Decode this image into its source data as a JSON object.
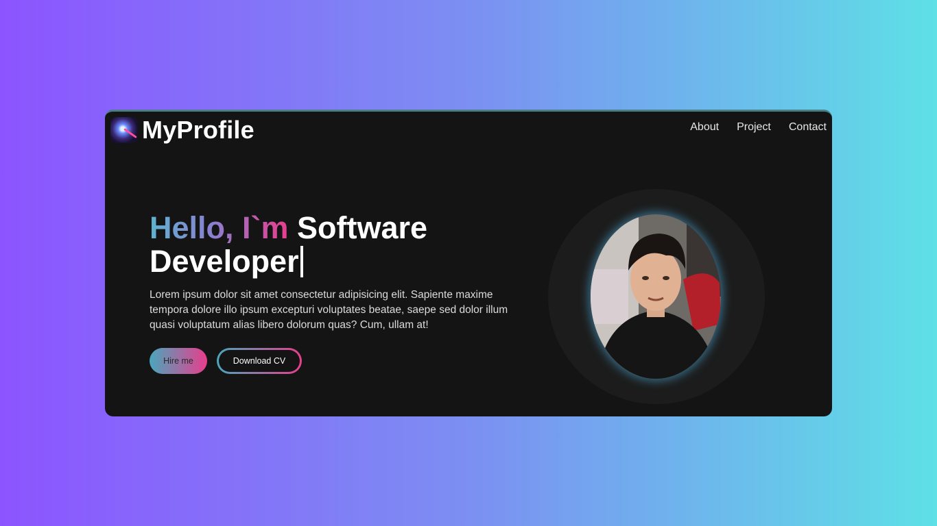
{
  "brand": {
    "name": "MyProfile",
    "logo_icon": "galaxy-logo-icon"
  },
  "nav": {
    "items": [
      {
        "label": "About"
      },
      {
        "label": "Project"
      },
      {
        "label": "Contact"
      }
    ]
  },
  "hero": {
    "greeting": "Hello, I`m",
    "role_line1": "Software",
    "role_line2": "Developer",
    "description": "Lorem ipsum dolor sit amet consectetur adipisicing elit. Sapiente maxime tempora dolore illo ipsum excepturi voluptates beatae, saepe sed dolor illum quasi voluptatum alias libero dolorum quas? Cum, ullam at!",
    "hire_label": "Hire me",
    "cv_label": "Download CV"
  },
  "colors": {
    "page_gradient_start": "#8c54ff",
    "page_gradient_end": "#5ee0e6",
    "card_background": "#141414",
    "accent_teal": "#4aa6bc",
    "accent_pink": "#e83e8c"
  }
}
